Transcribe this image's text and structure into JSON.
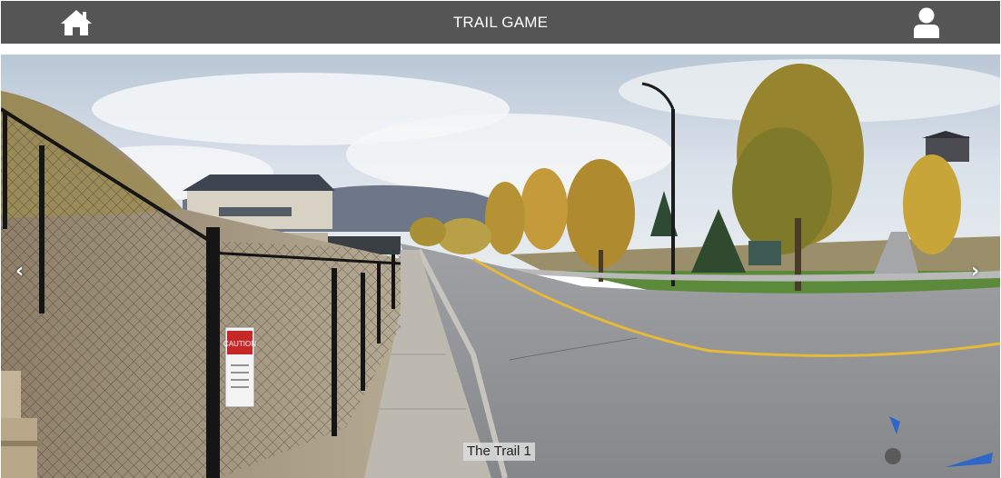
{
  "header": {
    "title": "TRAIL GAME",
    "home_icon": "home-icon",
    "user_icon": "user-icon",
    "background_color": "#555555"
  },
  "viewer": {
    "caption": "The Trail 1",
    "prev_icon": "chevron-left-icon",
    "next_icon": "chevron-right-icon",
    "prev_glyph": "‹",
    "next_glyph": "›",
    "sign_text": "CAUTION"
  }
}
